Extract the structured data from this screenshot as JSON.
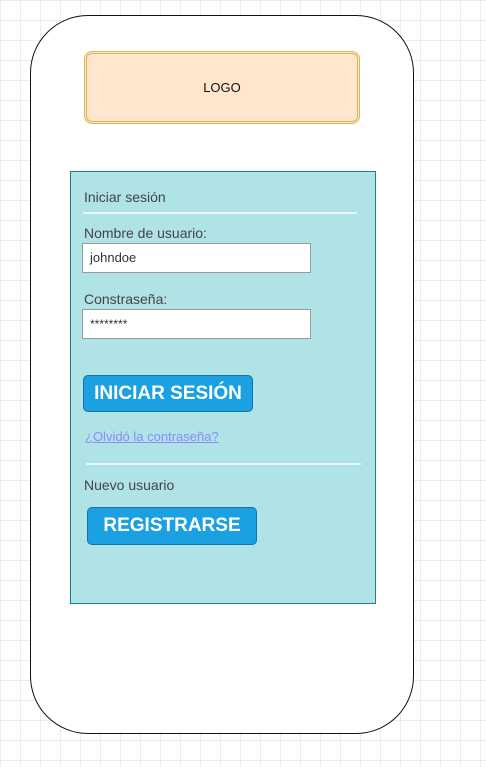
{
  "logo": {
    "text": "LOGO"
  },
  "login": {
    "title": "Iniciar sesión",
    "username_label": "Nombre de usuario:",
    "username_value": "johndoe",
    "password_label": "Constraseña:",
    "password_value": "********",
    "submit_label": "INICIAR SESIÓN",
    "forgot_link": "¿Olvidó la contraseña?"
  },
  "register": {
    "title": "Nuevo usuario",
    "button_label": "REGISTRARSE"
  },
  "colors": {
    "panel_fill": "#b0e3e6",
    "panel_border": "#1d7f92",
    "logo_fill": "#ffe6cc",
    "logo_border": "#d6b656",
    "button_fill": "#1ba1e2",
    "link": "#8a8aff"
  }
}
